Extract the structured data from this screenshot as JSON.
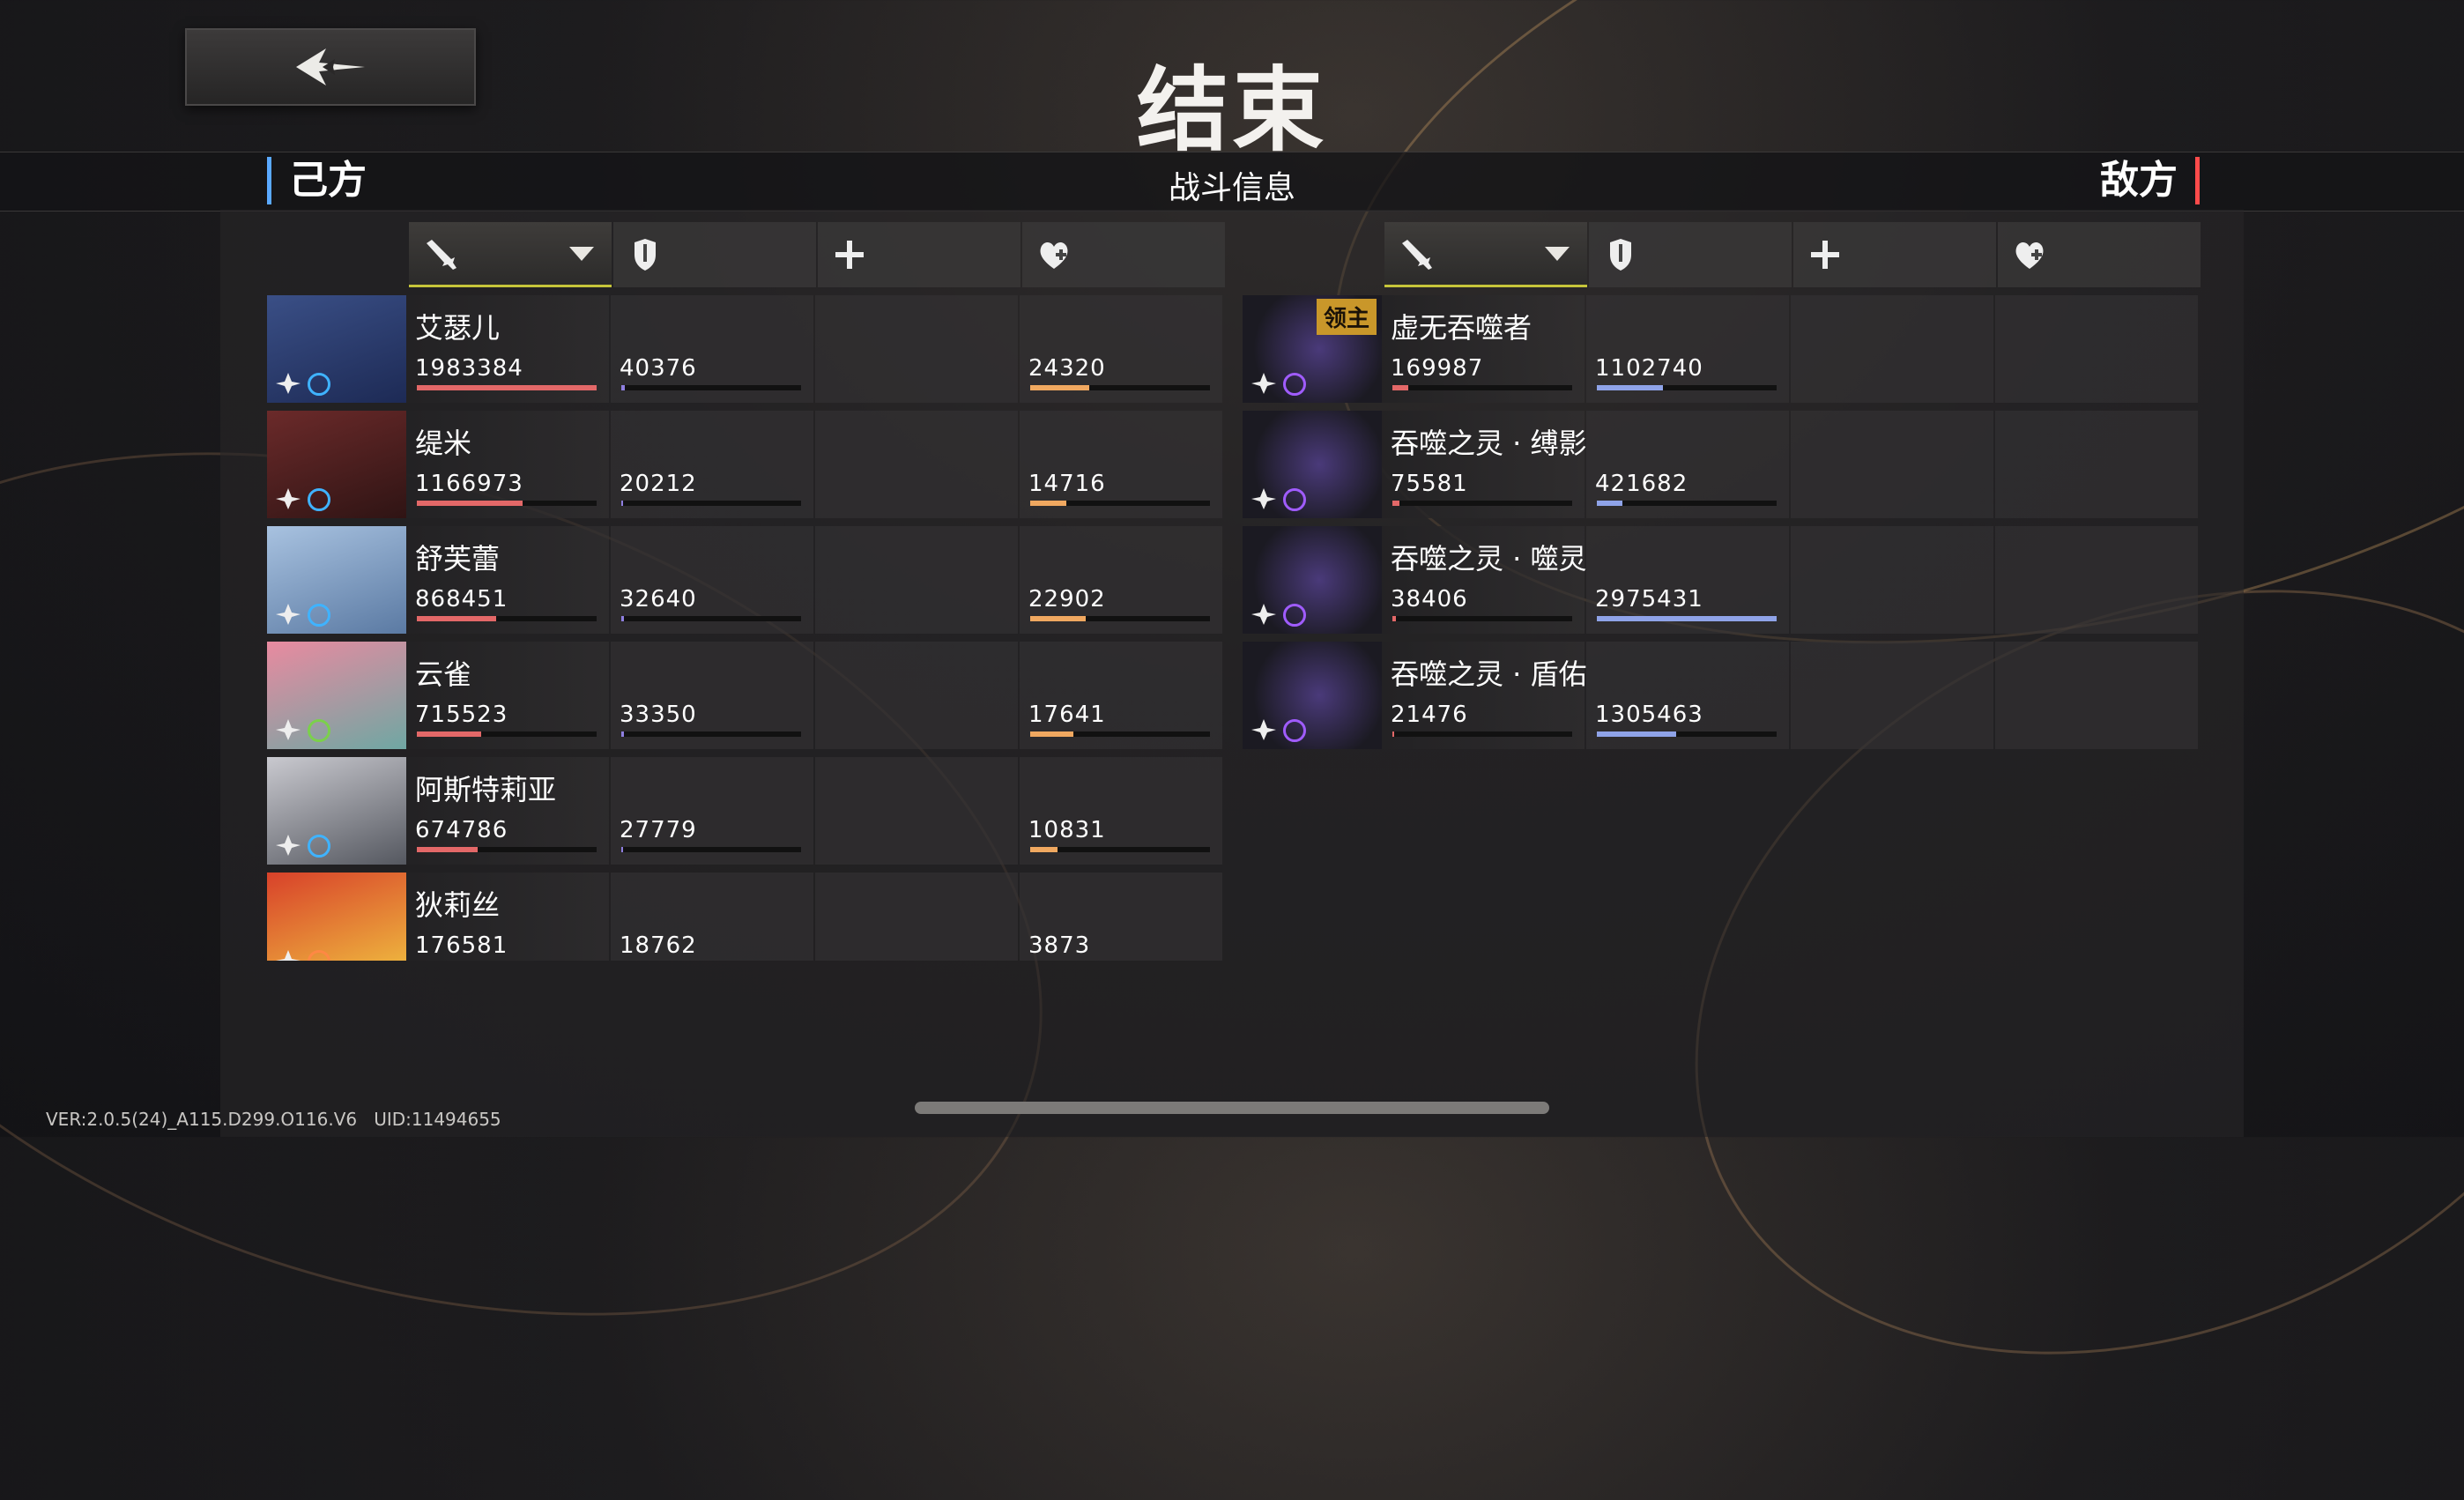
{
  "title": "结束",
  "banner": {
    "ally_label": "己方",
    "center_label": "战斗信息",
    "enemy_label": "敌方"
  },
  "header_icons": [
    "sword-icon",
    "shield-icon",
    "plus-icon",
    "heal-heart-icon"
  ],
  "colors": {
    "damage": "#e36868",
    "tank": "#8fa3e8",
    "heal": "#f0a860",
    "accent": "#c6c53a"
  },
  "allies": [
    {
      "name": "艾瑟儿",
      "damage": "1983384",
      "damage_ratio": 1.0,
      "tank": "40376",
      "tank_ratio": 0.02,
      "heal": "24320",
      "heal_ratio": 0.33,
      "element": "ice"
    },
    {
      "name": "缇米",
      "damage": "1166973",
      "damage_ratio": 0.59,
      "tank": "20212",
      "tank_ratio": 0.01,
      "heal": "14716",
      "heal_ratio": 0.2,
      "element": "ice"
    },
    {
      "name": "舒芙蕾",
      "damage": "868451",
      "damage_ratio": 0.44,
      "tank": "32640",
      "tank_ratio": 0.015,
      "heal": "22902",
      "heal_ratio": 0.31,
      "element": "ice"
    },
    {
      "name": "云雀",
      "damage": "715523",
      "damage_ratio": 0.36,
      "tank": "33350",
      "tank_ratio": 0.015,
      "heal": "17641",
      "heal_ratio": 0.24,
      "element": "nature"
    },
    {
      "name": "阿斯特莉亚",
      "damage": "674786",
      "damage_ratio": 0.34,
      "tank": "27779",
      "tank_ratio": 0.012,
      "heal": "10831",
      "heal_ratio": 0.15,
      "element": "ice"
    },
    {
      "name": "狄莉丝",
      "damage": "176581",
      "damage_ratio": 0.09,
      "tank": "18762",
      "tank_ratio": 0.008,
      "heal": "3873",
      "heal_ratio": 0.05,
      "element": "fire"
    }
  ],
  "enemies": [
    {
      "name": "虚无吞噬者",
      "badge": "领主",
      "damage": "169987",
      "damage_ratio": 0.09,
      "tank": "1102740",
      "tank_ratio": 0.37
    },
    {
      "name": "吞噬之灵 · 缚影",
      "badge": "",
      "damage": "75581",
      "damage_ratio": 0.04,
      "tank": "421682",
      "tank_ratio": 0.14
    },
    {
      "name": "吞噬之灵 · 噬灵",
      "badge": "",
      "damage": "38406",
      "damage_ratio": 0.02,
      "tank": "2975431",
      "tank_ratio": 1.0
    },
    {
      "name": "吞噬之灵 · 盾佑",
      "badge": "",
      "damage": "21476",
      "damage_ratio": 0.01,
      "tank": "1305463",
      "tank_ratio": 0.44
    }
  ],
  "footer": {
    "version": "VER:2.0.5(24)_A115.D299.O116.V6",
    "uid": "UID:11494655"
  }
}
